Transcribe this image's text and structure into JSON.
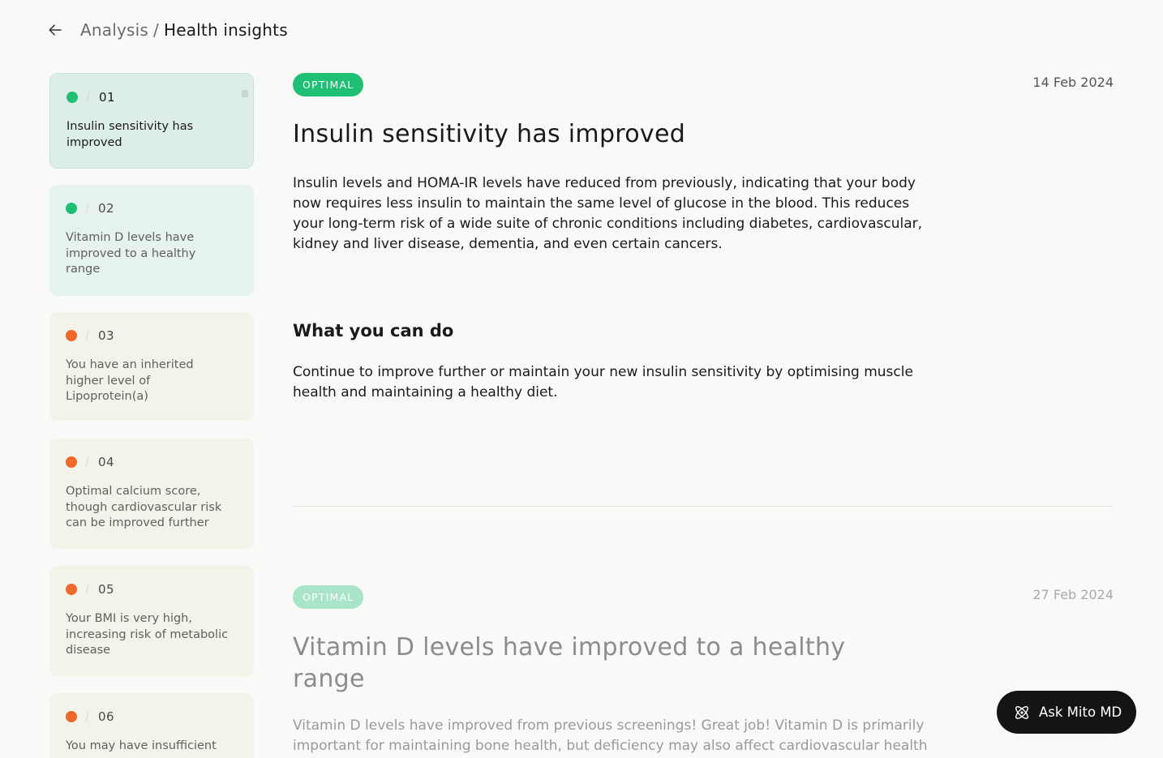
{
  "header": {
    "breadcrumb_parent": "Analysis",
    "breadcrumb_separator": "/",
    "breadcrumb_current": "Health insights",
    "back_icon": "arrow-left-icon"
  },
  "sidebar": {
    "items": [
      {
        "number": "01",
        "status": "green",
        "label": "Insulin sensitivity has improved"
      },
      {
        "number": "02",
        "status": "green",
        "label": "Vitamin D levels have improved to a healthy range"
      },
      {
        "number": "03",
        "status": "orange",
        "label": "You have an inherited higher level of Lipoprotein(a)"
      },
      {
        "number": "04",
        "status": "orange",
        "label": "Optimal calcium score, though cardiovascular risk can be improved further"
      },
      {
        "number": "05",
        "status": "orange",
        "label": "Your BMI is very high, increasing risk of metabolic disease"
      },
      {
        "number": "06",
        "status": "orange",
        "label": "You may have insufficient"
      }
    ]
  },
  "insights": [
    {
      "badge": "OPTIMAL",
      "date": "14 Feb 2024",
      "title": "Insulin sensitivity has improved",
      "body": "Insulin levels and HOMA-IR levels have reduced from previously, indicating that your body now requires less insulin to maintain the same level of glucose in the blood. This reduces your long-term risk of a wide suite of chronic conditions including diabetes, cardiovascular, kidney and liver disease, dementia, and even certain cancers.",
      "action_heading": "What you can do",
      "action_body": "Continue to improve further or maintain your new insulin sensitivity by optimising muscle health and maintaining a healthy diet."
    },
    {
      "badge": "OPTIMAL",
      "date": "27 Feb 2024",
      "title": "Vitamin D levels have improved to a healthy range",
      "body": "Vitamin D levels have improved from previous screenings! Great job! Vitamin D is primarily important for maintaining bone health, but deficiency may also affect cardiovascular health"
    }
  ],
  "ask_button": {
    "label": "Ask Mito MD",
    "icon": "atom-icon"
  },
  "colors": {
    "optimal_green": "#1fbf74",
    "warning_orange": "#ee6a2c",
    "button_dark": "#141414"
  }
}
